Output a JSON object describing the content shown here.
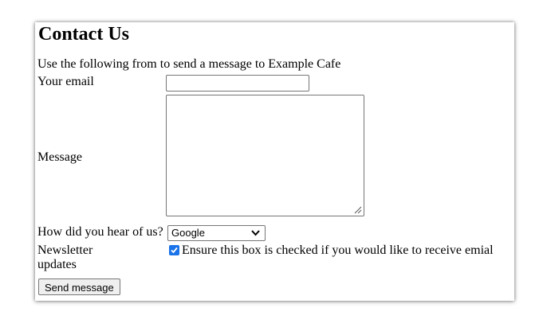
{
  "page": {
    "title": "Contact Us",
    "intro": "Use the following from to send a message to Example Cafe"
  },
  "form": {
    "email_label": "Your email",
    "email_value": "",
    "message_label": "Message",
    "message_value": "",
    "hear_label": "How did you hear of us?",
    "hear_selected": "Google",
    "newsletter_label": "Newsletter updates",
    "newsletter_checked": true,
    "newsletter_text": "Ensure this box is checked if you would like to receive emial",
    "submit_label": "Send message"
  },
  "colors": {
    "checkbox_accent": "#1a73e8"
  },
  "icons": {
    "select_arrow": "chevron-down-icon",
    "textarea_resize": "resize-grip-icon",
    "checkbox_mark": "checkmark-icon"
  }
}
